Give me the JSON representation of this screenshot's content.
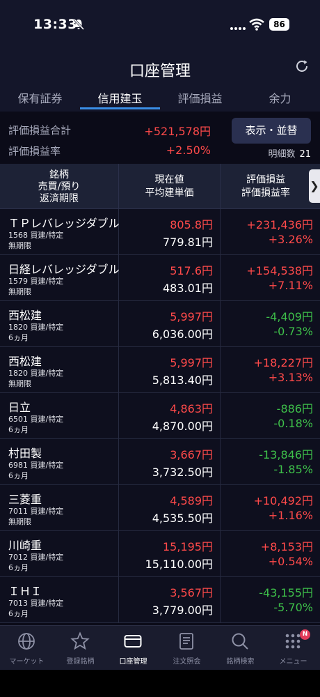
{
  "status_bar": {
    "time": "13:33",
    "battery": "86"
  },
  "header": {
    "title": "口座管理"
  },
  "tabs": [
    {
      "label": "保有証券",
      "active": false
    },
    {
      "label": "信用建玉",
      "active": true
    },
    {
      "label": "評価損益",
      "active": false
    },
    {
      "label": "余力",
      "active": false
    }
  ],
  "summary": {
    "total_label": "評価損益合計",
    "total_value": "+521,578円",
    "rate_label": "評価損益率",
    "rate_value": "+2.50%",
    "display_button": "表示・並替",
    "count_label": "明細数",
    "count_value": "21"
  },
  "table_header": {
    "col1": [
      "銘柄",
      "売買/預り",
      "返済期限"
    ],
    "col2": [
      "現在値",
      "平均建単価"
    ],
    "col3": [
      "評価損益",
      "評価損益率"
    ]
  },
  "rows": [
    {
      "name": "ＴＰレバレッジダブル",
      "code": "1568 買建/特定",
      "term": "無期限",
      "price": "805.8円",
      "avg": "779.81円",
      "pl": "+231,436円",
      "plr": "+3.26%",
      "sign": "pos"
    },
    {
      "name": "日経レバレッジダブル",
      "code": "1579 買建/特定",
      "term": "無期限",
      "price": "517.6円",
      "avg": "483.01円",
      "pl": "+154,538円",
      "plr": "+7.11%",
      "sign": "pos"
    },
    {
      "name": "西松建",
      "code": "1820 買建/特定",
      "term": "6ヵ月",
      "price": "5,997円",
      "avg": "6,036.00円",
      "pl": "-4,409円",
      "plr": "-0.73%",
      "sign": "neg"
    },
    {
      "name": "西松建",
      "code": "1820 買建/特定",
      "term": "無期限",
      "price": "5,997円",
      "avg": "5,813.40円",
      "pl": "+18,227円",
      "plr": "+3.13%",
      "sign": "pos"
    },
    {
      "name": "日立",
      "code": "6501 買建/特定",
      "term": "6ヵ月",
      "price": "4,863円",
      "avg": "4,870.00円",
      "pl": "-886円",
      "plr": "-0.18%",
      "sign": "neg"
    },
    {
      "name": "村田製",
      "code": "6981 買建/特定",
      "term": "6ヵ月",
      "price": "3,667円",
      "avg": "3,732.50円",
      "pl": "-13,846円",
      "plr": "-1.85%",
      "sign": "neg"
    },
    {
      "name": "三菱重",
      "code": "7011 買建/特定",
      "term": "無期限",
      "price": "4,589円",
      "avg": "4,535.50円",
      "pl": "+10,492円",
      "plr": "+1.16%",
      "sign": "pos"
    },
    {
      "name": "川崎重",
      "code": "7012 買建/特定",
      "term": "6ヵ月",
      "price": "15,195円",
      "avg": "15,110.00円",
      "pl": "+8,153円",
      "plr": "+0.54%",
      "sign": "pos"
    },
    {
      "name": "ＩＨＩ",
      "code": "7013 買建/特定",
      "term": "6ヵ月",
      "price": "3,567円",
      "avg": "3,779.00円",
      "pl": "-43,155円",
      "plr": "-5.70%",
      "sign": "neg"
    }
  ],
  "tabbar": [
    {
      "label": "マーケット",
      "icon": "globe-icon",
      "active": false
    },
    {
      "label": "登録銘柄",
      "icon": "star-icon",
      "active": false
    },
    {
      "label": "口座管理",
      "icon": "card-icon",
      "active": true
    },
    {
      "label": "注文照会",
      "icon": "document-icon",
      "active": false
    },
    {
      "label": "銘柄検索",
      "icon": "search-icon",
      "active": false
    },
    {
      "label": "メニュー",
      "icon": "grid-menu-icon",
      "active": false
    }
  ],
  "menu_badge": "N",
  "colors": {
    "positive": "#ff4a4a",
    "negative": "#3ec04a",
    "accent": "#3a8ee6"
  }
}
